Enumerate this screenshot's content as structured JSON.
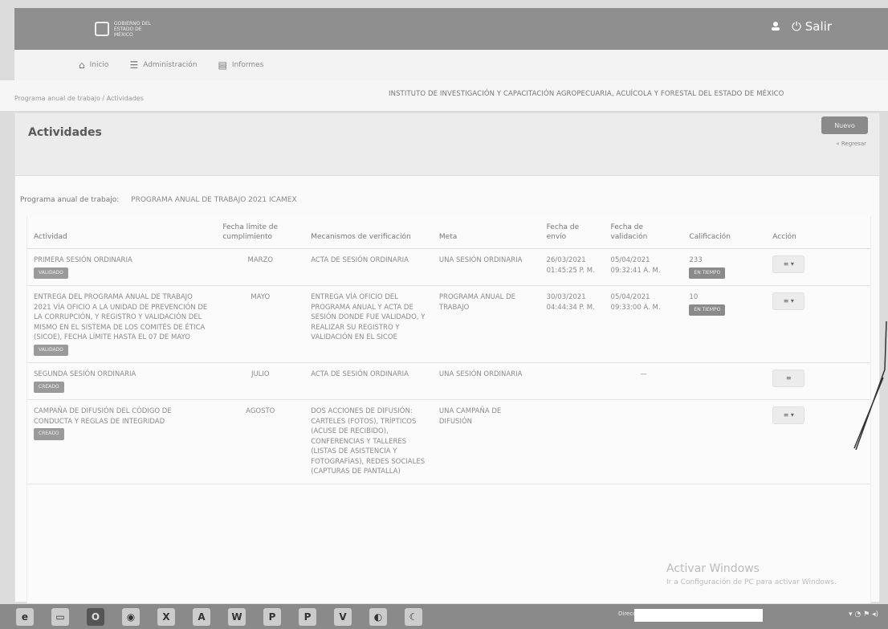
{
  "header": {
    "logo_text": "GOBIERNO DEL ESTADO DE MÉXICO",
    "logout_label": "Salir"
  },
  "nav": {
    "items": [
      {
        "icon": "home-icon",
        "label": "Inicio"
      },
      {
        "icon": "list-icon",
        "label": "Administración"
      },
      {
        "icon": "report-icon",
        "label": "Informes"
      }
    ]
  },
  "breadcrumb": "Programa anual de trabajo  /  Actividades",
  "institute": "INSTITUTO DE INVESTIGACIÓN Y CAPACITACIÓN AGROPECUARIA, ACUÍCOLA Y FORESTAL DEL ESTADO DE MÉXICO",
  "page": {
    "title": "Actividades",
    "new_button": "Nuevo",
    "back_link": "« Regresar",
    "program_label": "Programa anual de trabajo:",
    "program_value": "PROGRAMA ANUAL DE TRABAJO 2021 ICAMEX"
  },
  "table": {
    "headers": {
      "actividad": "Actividad",
      "fecha_limite": "Fecha límite de cumplimiento",
      "mecanismos": "Mecanismos de verificación",
      "meta": "Meta",
      "fecha_envio": "Fecha de envío",
      "fecha_validacion": "Fecha de validación",
      "calificacion": "Calificación",
      "accion": "Acción"
    },
    "rows": [
      {
        "actividad": "PRIMERA SESIÓN ORDINARIA",
        "estado": "VALIDADO",
        "fecha_limite": "MARZO",
        "mecanismos": "ACTA DE SESIÓN ORDINARIA",
        "meta": "UNA SESIÓN ORDINARIA",
        "fecha_envio": "26/03/2021 01:45:25 p. m.",
        "fecha_validacion": "05/04/2021 09:32:41 a. m.",
        "calificacion": "233",
        "calificacion_badge": "EN TIEMPO",
        "accion": "≡ ▾"
      },
      {
        "actividad": "ENTREGA DEL PROGRAMA ANUAL DE TRABAJO 2021 VÍA OFICIO A LA UNIDAD DE PREVENCIÓN DE LA CORRUPCIÓN, Y REGISTRO Y VALIDACIÓN DEL MISMO EN EL SISTEMA DE LOS COMITÉS DE ÉTICA (SICOE), FECHA LÍMITE HASTA EL 07 DE MAYO",
        "estado": "VALIDADO",
        "fecha_limite": "MAYO",
        "mecanismos": "ENTREGA VÍA OFICIO DEL PROGRAMA ANUAL Y ACTA DE SESIÓN DONDE FUE VALIDADO, Y REALIZAR SU REGISTRO Y VALIDACIÓN EN EL SICOE",
        "meta": "PROGRAMA ANUAL DE TRABAJO",
        "fecha_envio": "30/03/2021 04:44:34 p. m.",
        "fecha_validacion": "05/04/2021 09:33:00 a. m.",
        "calificacion": "10",
        "calificacion_badge": "EN TIEMPO",
        "accion": "≡ ▾"
      },
      {
        "actividad": "SEGUNDA SESIÓN ORDINARIA",
        "estado": "CREADO",
        "fecha_limite": "JULIO",
        "mecanismos": "ACTA DE SESIÓN ORDINARIA",
        "meta": "UNA SESIÓN ORDINARIA",
        "fecha_envio": "",
        "fecha_validacion": "—",
        "calificacion": "",
        "calificacion_badge": "",
        "accion": "≡"
      },
      {
        "actividad": "CAMPAÑA DE DIFUSIÓN DEL CÓDIGO DE CONDUCTA Y REGLAS DE INTEGRIDAD",
        "estado": "CREADO",
        "fecha_limite": "AGOSTO",
        "mecanismos": "DOS ACCIONES DE DIFUSIÓN: CARTELES (FOTOS), TRÍPTICOS (ACUSE DE RECIBIDO), CONFERENCIAS Y TALLERES (LISTAS DE ASISTENCIA Y FOTOGRAFÍAS), REDES SOCIALES (CAPTURAS DE PANTALLA)",
        "meta": "UNA CAMPAÑA DE DIFUSIÓN",
        "fecha_envio": "",
        "fecha_validacion": "",
        "calificacion": "",
        "calificacion_badge": "",
        "accion": "≡ ▾"
      }
    ]
  },
  "watermark": {
    "line1": "Activar Windows",
    "line2": "Ir a Configuración de PC para activar Windows."
  },
  "taskbar": {
    "address_label": "Dirección",
    "icons": [
      "ie-icon",
      "folder-icon",
      "outlook-icon",
      "chrome-icon",
      "excel-icon",
      "access-icon",
      "word-icon",
      "publisher-icon",
      "powerpoint-icon",
      "visio-icon",
      "paint-icon",
      "moon-icon"
    ]
  }
}
